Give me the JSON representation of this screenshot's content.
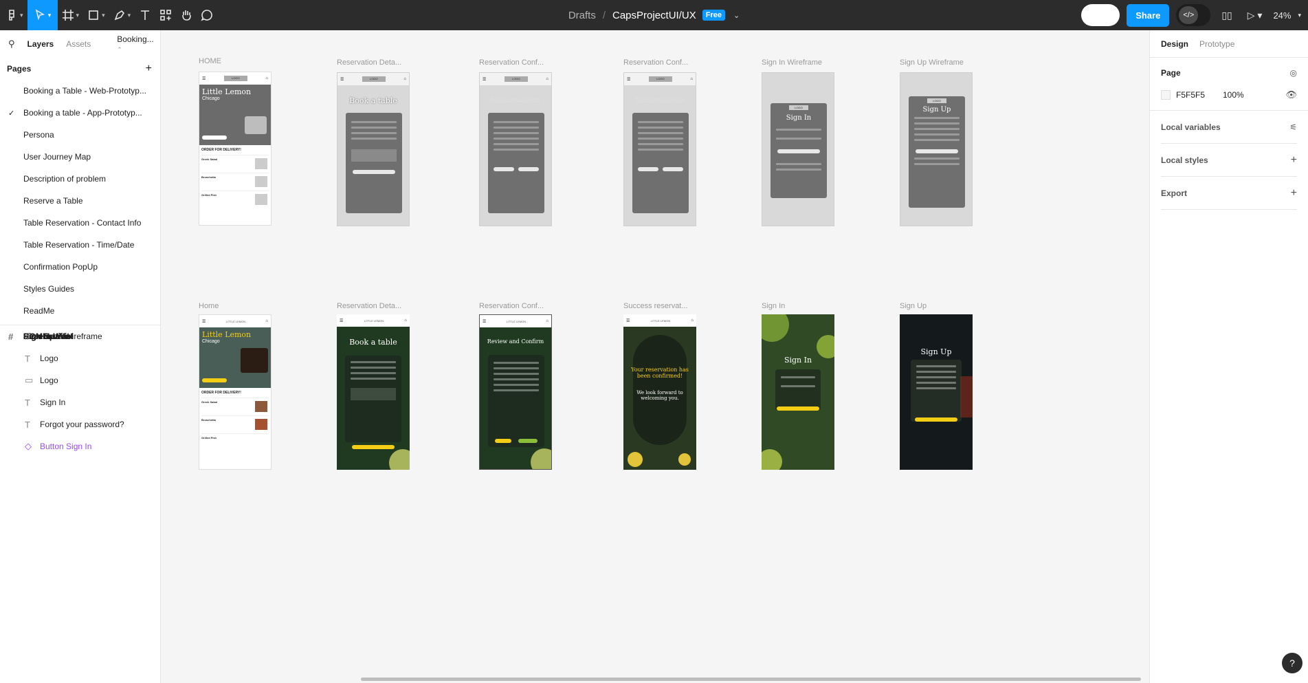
{
  "toolbar": {
    "breadcrumb": "Drafts",
    "separator": "/",
    "file_name": "CapsProjectUI/UX",
    "plan_badge": "Free",
    "share_label": "Share",
    "dev_mode_label": "</>",
    "zoom": "24%"
  },
  "left_panel": {
    "tabs": [
      "Layers",
      "Assets"
    ],
    "page_switcher": "Booking...",
    "pages_heading": "Pages",
    "pages": [
      {
        "label": "Booking a Table - Web-Prototyp...",
        "current": false
      },
      {
        "label": "Booking a table - App-Prototyp...",
        "current": true
      },
      {
        "label": "Persona",
        "current": false
      },
      {
        "label": "User Journey Map",
        "current": false
      },
      {
        "label": "Description of problem",
        "current": false
      },
      {
        "label": "Reserve a Table",
        "current": false
      },
      {
        "label": "Table Reservation - Contact Info",
        "current": false
      },
      {
        "label": "Table Reservation - Time/Date",
        "current": false
      },
      {
        "label": "Confirmation PopUp",
        "current": false
      },
      {
        "label": "Styles Guides",
        "current": false
      },
      {
        "label": "ReadMe",
        "current": false
      }
    ],
    "layers": [
      {
        "label": "Sign In",
        "type": "frame"
      },
      {
        "label": "Sign Up Wireframe",
        "type": "frame"
      },
      {
        "label": "Sign In Wireframe",
        "type": "frame"
      },
      {
        "label": "Sign Up",
        "type": "frame"
      },
      {
        "label": "Reservation Confirmation Wirefra...",
        "type": "frame"
      },
      {
        "label": "Reservation Confirmation Wirefra...",
        "type": "frame"
      },
      {
        "label": "Reservation Details Wireframe",
        "type": "frame"
      },
      {
        "label": "HOME",
        "type": "frame"
      },
      {
        "label": "Sign Up Wireframe",
        "type": "frame-plain"
      },
      {
        "label": "Sign In Wireframe",
        "type": "frame-plain"
      },
      {
        "label": "Home Wireframe",
        "type": "child-frame"
      },
      {
        "label": "Logo",
        "type": "text"
      },
      {
        "label": "Logo",
        "type": "rect"
      },
      {
        "label": "Sign In",
        "type": "text"
      },
      {
        "label": "Forgot your password?",
        "type": "text"
      },
      {
        "label": "Button Sign In",
        "type": "component"
      }
    ]
  },
  "canvas": {
    "row1_labels": [
      "HOME",
      "Reservation Deta...",
      "Reservation Conf...",
      "Reservation Conf...",
      "Sign In Wireframe",
      "Sign Up Wireframe"
    ],
    "row2_labels": [
      "Home",
      "Reservation Deta...",
      "Reservation Conf...",
      "Success reservat...",
      "Sign In",
      "Sign Up"
    ],
    "mock": {
      "logo": "LOGO",
      "brand_title": "Little Lemon",
      "brand_city": "Chicago",
      "order_heading": "ORDER FOR DELIVERY!",
      "book_title": "Book a table",
      "review_title": "Review and Confirm",
      "signin_title": "Sign In",
      "signup_title": "Sign Up",
      "success_line1": "Your reservation has been confirmed!",
      "success_line2": "We look forward to welcoming you.",
      "menu_items": [
        "Greek Salad",
        "Bruschetta",
        "Grilled Fish"
      ],
      "brand_small": "LITTLE LEMON"
    }
  },
  "right_panel": {
    "tabs": [
      "Design",
      "Prototype"
    ],
    "page_heading": "Page",
    "page_color": "F5F5F5",
    "page_opacity": "100%",
    "sections": [
      "Local variables",
      "Local styles",
      "Export"
    ]
  },
  "colors": {
    "accent": "#0d99ff",
    "toolbar_bg": "#2c2c2c",
    "canvas_bg": "#f5f5f5",
    "component_purple": "#9747ff",
    "lemon_yellow": "#f4ce14"
  }
}
